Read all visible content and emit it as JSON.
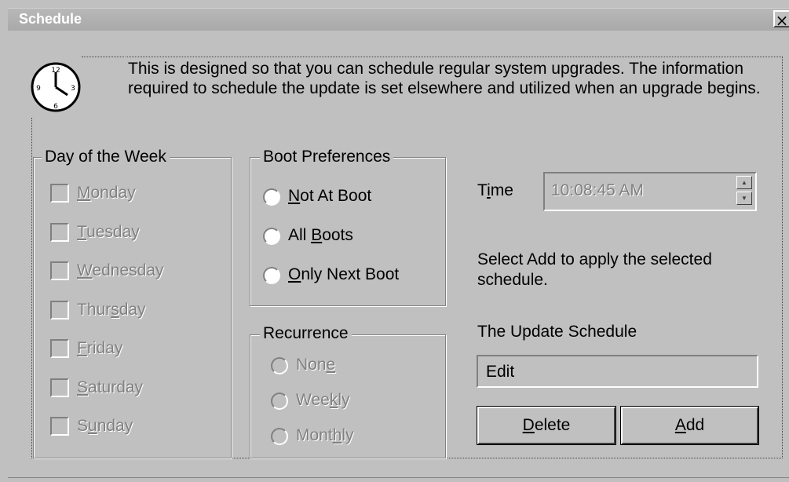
{
  "window": {
    "title": "Schedule",
    "close_glyph": "×"
  },
  "description": "This is designed so that you can schedule regular system upgrades.  The information required to schedule the update is set elsewhere and utilized when an upgrade begins.",
  "clock_icon": "clock-icon",
  "day_of_week": {
    "legend": "Day of the Week",
    "days": [
      {
        "pre": "",
        "key": "M",
        "post": "onday",
        "checked": false,
        "disabled": true
      },
      {
        "pre": "",
        "key": "T",
        "post": "uesday",
        "checked": false,
        "disabled": true
      },
      {
        "pre": "",
        "key": "W",
        "post": "ednesday",
        "checked": false,
        "disabled": true
      },
      {
        "pre": "Thur",
        "key": "s",
        "post": "day",
        "checked": false,
        "disabled": true
      },
      {
        "pre": "",
        "key": "F",
        "post": "riday",
        "checked": false,
        "disabled": true
      },
      {
        "pre": "",
        "key": "S",
        "post": "aturday",
        "checked": false,
        "disabled": true
      },
      {
        "pre": "S",
        "key": "u",
        "post": "nday",
        "checked": false,
        "disabled": true
      }
    ]
  },
  "boot_preferences": {
    "legend": "Boot Preferences",
    "options": [
      {
        "pre": "",
        "key": "N",
        "post": "ot At Boot",
        "selected": false
      },
      {
        "pre": "All ",
        "key": "B",
        "post": "oots",
        "selected": false
      },
      {
        "pre": "",
        "key": "O",
        "post": "nly Next Boot",
        "selected": false
      }
    ]
  },
  "recurrence": {
    "legend": "Recurrence",
    "options": [
      {
        "pre": "Non",
        "key": "e",
        "post": "",
        "disabled": true
      },
      {
        "pre": "Wee",
        "key": "k",
        "post": "ly",
        "disabled": true
      },
      {
        "pre": "Mont",
        "key": "h",
        "post": "ly",
        "disabled": true
      }
    ]
  },
  "time": {
    "label_pre": "T",
    "label_key": "i",
    "label_post": "me",
    "value": "10:08:45 AM",
    "up_glyph": "▲",
    "down_glyph": "▼"
  },
  "hint": "Select Add to apply the selected schedule.",
  "update_schedule": {
    "label": "The Update Schedule",
    "value": "Edit"
  },
  "buttons": {
    "delete_key": "D",
    "delete_rest": "elete",
    "add_key": "A",
    "add_rest": "dd"
  },
  "colors": {
    "face": "#c0c0c0",
    "shadow": "#808080",
    "highlight": "#ffffff",
    "disabled_text": "#808080"
  }
}
